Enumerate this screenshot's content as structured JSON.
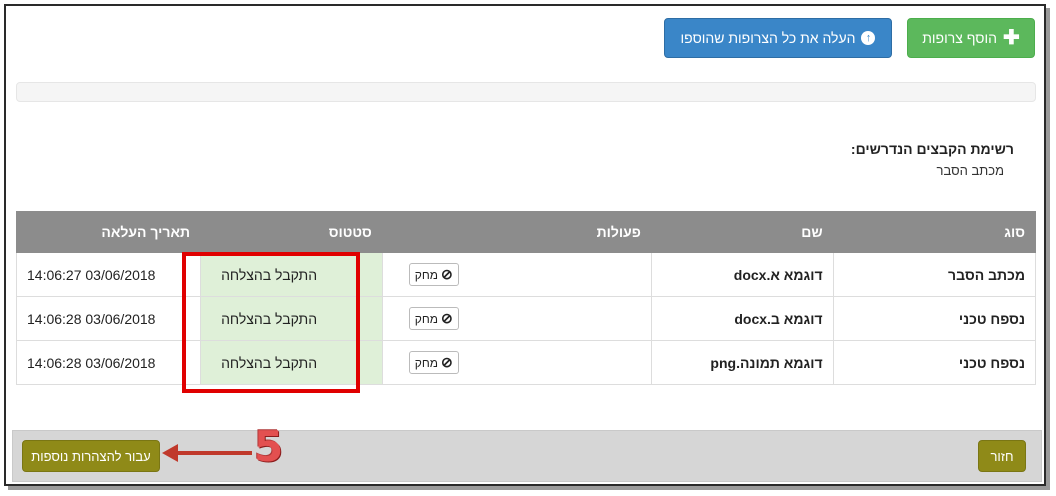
{
  "toolbar": {
    "add_attachments_label": "הוסף צרופות",
    "upload_all_label": "העלה את כל הצרופות שהוספו"
  },
  "progress": {
    "value_percent": 0
  },
  "required_files": {
    "title": "רשימת הקבצים הנדרשים:",
    "items": [
      "מכתב הסבר"
    ]
  },
  "table": {
    "headers": {
      "type": "סוג",
      "name": "שם",
      "actions": "פעולות",
      "status": "סטטוס",
      "upload_date": "תאריך העלאה"
    },
    "rows": [
      {
        "type": "מכתב הסבר",
        "name": "דוגמא א.docx",
        "delete_label": "מחק",
        "status": "התקבל בהצלחה",
        "upload_date": "03/06/2018 14:06:27"
      },
      {
        "type": "נספח טכני",
        "name": "דוגמא ב.docx",
        "delete_label": "מחק",
        "status": "התקבל בהצלחה",
        "upload_date": "03/06/2018 14:06:28"
      },
      {
        "type": "נספח טכני",
        "name": "דוגמא תמונה.png",
        "delete_label": "מחק",
        "status": "התקבל בהצלחה",
        "upload_date": "03/06/2018 14:06:28"
      }
    ]
  },
  "footer": {
    "back_label": "חזור",
    "next_label": "עבור להצהרות נוספות"
  },
  "annotation": {
    "step_number": "5"
  },
  "colors": {
    "success_bg": "#dff0d8",
    "highlight_border": "#e00000",
    "arrow": "#c0392b",
    "green_button": "#5cb85c",
    "blue_button": "#3a86c8",
    "olive_button": "#8f8a18"
  }
}
